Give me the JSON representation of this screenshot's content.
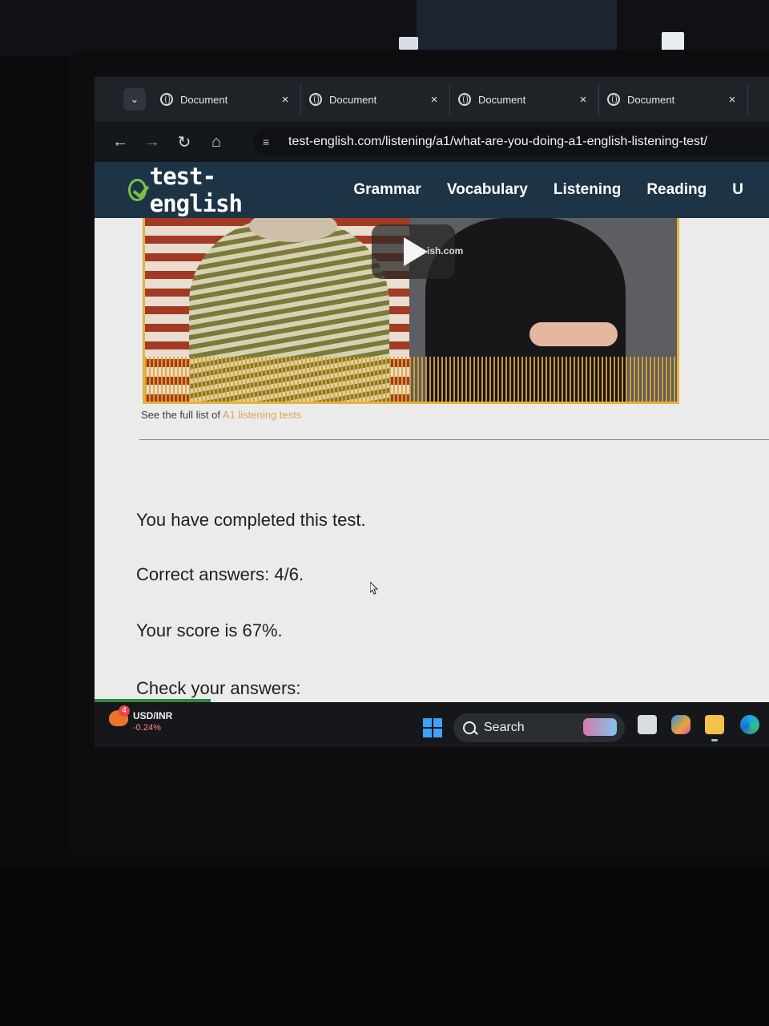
{
  "browser": {
    "tabs": [
      {
        "title": "Document",
        "close": "×"
      },
      {
        "title": "Document",
        "close": "×"
      },
      {
        "title": "Document",
        "close": "×"
      },
      {
        "title": "Document",
        "close": "×"
      }
    ],
    "url": "test-english.com/listening/a1/what-are-you-doing-a1-english-listening-test/"
  },
  "site": {
    "logo_text": "test-english",
    "menu": [
      "Grammar",
      "Vocabulary",
      "Listening",
      "Reading",
      "U"
    ]
  },
  "media": {
    "watermark": "ish.com"
  },
  "content": {
    "full_list_prefix": "See the full list of ",
    "full_list_link": "A1 listening tests",
    "completed": "You have completed this test.",
    "correct": "Correct answers: 4/6.",
    "score": "Your score is 67%.",
    "check": "Check your answers:"
  },
  "taskbar": {
    "widget_title": "USD/INR",
    "widget_change": "-0.24%",
    "widget_badge": "4",
    "search_label": "Search"
  },
  "colors": {
    "site_header": "#1d3346",
    "logo_green": "#7bc043",
    "media_border": "#e3b33c",
    "link_orange": "#e4a25a"
  },
  "icons": [
    "chevron-down-icon",
    "globe-icon",
    "close-icon",
    "back-arrow-icon",
    "forward-arrow-icon",
    "reload-icon",
    "home-icon",
    "site-info-icon",
    "play-icon",
    "windows-start-icon",
    "search-icon",
    "task-view-icon",
    "copilot-icon",
    "file-explorer-icon",
    "edge-icon"
  ]
}
